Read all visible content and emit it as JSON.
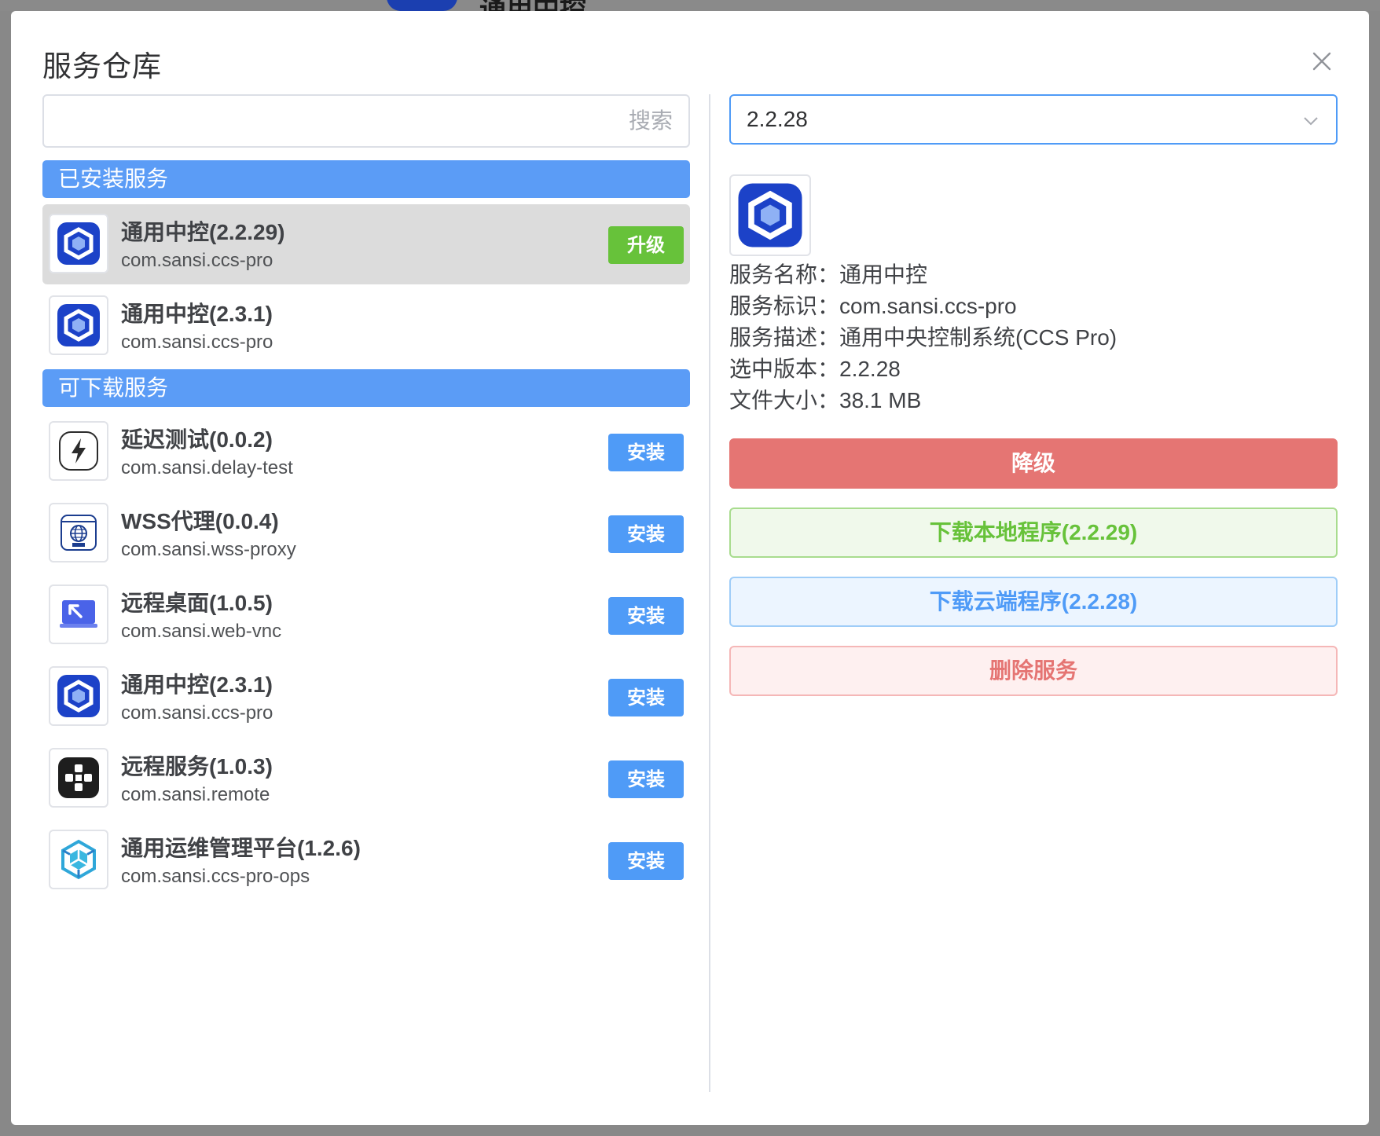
{
  "backdrop": {
    "title_fragment": "通用中控"
  },
  "modal": {
    "title": "服务仓库"
  },
  "search": {
    "placeholder": "搜索",
    "value": ""
  },
  "installed": {
    "header": "已安装服务",
    "items": [
      {
        "name": "通用中控(2.2.29)",
        "id": "com.sansi.ccs-pro",
        "icon": "ccs-hexagon-icon",
        "action": "升级",
        "selected": true
      },
      {
        "name": "通用中控(2.3.1)",
        "id": "com.sansi.ccs-pro",
        "icon": "ccs-hexagon-icon",
        "action": "",
        "selected": false
      }
    ]
  },
  "available": {
    "header": "可下载服务",
    "items": [
      {
        "name": "延迟测试(0.0.2)",
        "id": "com.sansi.delay-test",
        "icon": "lightning-icon",
        "action": "安装"
      },
      {
        "name": "WSS代理(0.0.4)",
        "id": "com.sansi.wss-proxy",
        "icon": "globe-wss-icon",
        "action": "安装"
      },
      {
        "name": "远程桌面(1.0.5)",
        "id": "com.sansi.web-vnc",
        "icon": "remote-desktop-icon",
        "action": "安装"
      },
      {
        "name": "通用中控(2.3.1)",
        "id": "com.sansi.ccs-pro",
        "icon": "ccs-hexagon-icon",
        "action": "安装"
      },
      {
        "name": "远程服务(1.0.3)",
        "id": "com.sansi.remote",
        "icon": "remote-service-icon",
        "action": "安装"
      },
      {
        "name": "通用运维管理平台(1.2.6)",
        "id": "com.sansi.ccs-pro-ops",
        "icon": "ops-cube-icon",
        "action": "安装"
      }
    ]
  },
  "detail": {
    "selected_version": "2.2.28",
    "icon": "ccs-hexagon-icon",
    "info": [
      "服务名称：通用中控",
      "服务标识：com.sansi.ccs-pro",
      "服务描述：通用中央控制系统(CCS Pro)",
      "选中版本：2.2.28",
      "文件大小：38.1 MB"
    ],
    "buttons": {
      "downgrade": "降级",
      "download_local": "下载本地程序(2.2.29)",
      "download_cloud": "下载云端程序(2.2.28)",
      "delete": "删除服务"
    }
  },
  "colors": {
    "primary": "#4f9bf7",
    "section_header": "#5b9cf6",
    "success": "#67c23a",
    "danger": "#e57573"
  }
}
